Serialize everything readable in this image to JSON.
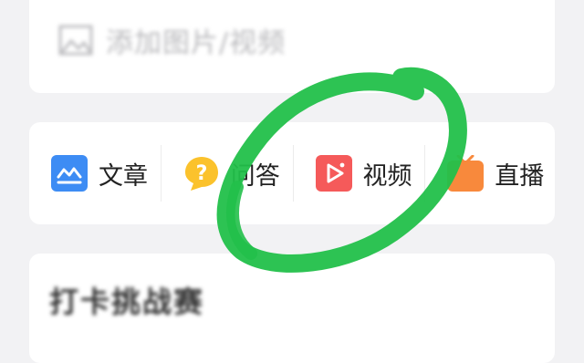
{
  "top_card": {
    "add_media_label": "添加图片/视频",
    "add_media_icon": "image-icon"
  },
  "creation_types": [
    {
      "label": "文章",
      "icon": "article-icon",
      "color": "#3d8cf4"
    },
    {
      "label": "问答",
      "icon": "question-icon",
      "color": "#fbc22c"
    },
    {
      "label": "视频",
      "icon": "video-play-icon",
      "color": "#f55a5a"
    },
    {
      "label": "直播",
      "icon": "live-tv-icon",
      "color": "#f8893c"
    }
  ],
  "bottom_card": {
    "title": "打卡挑战赛",
    "subtitle": ""
  },
  "annotation": {
    "color": "#22c04a",
    "target": "视频"
  }
}
